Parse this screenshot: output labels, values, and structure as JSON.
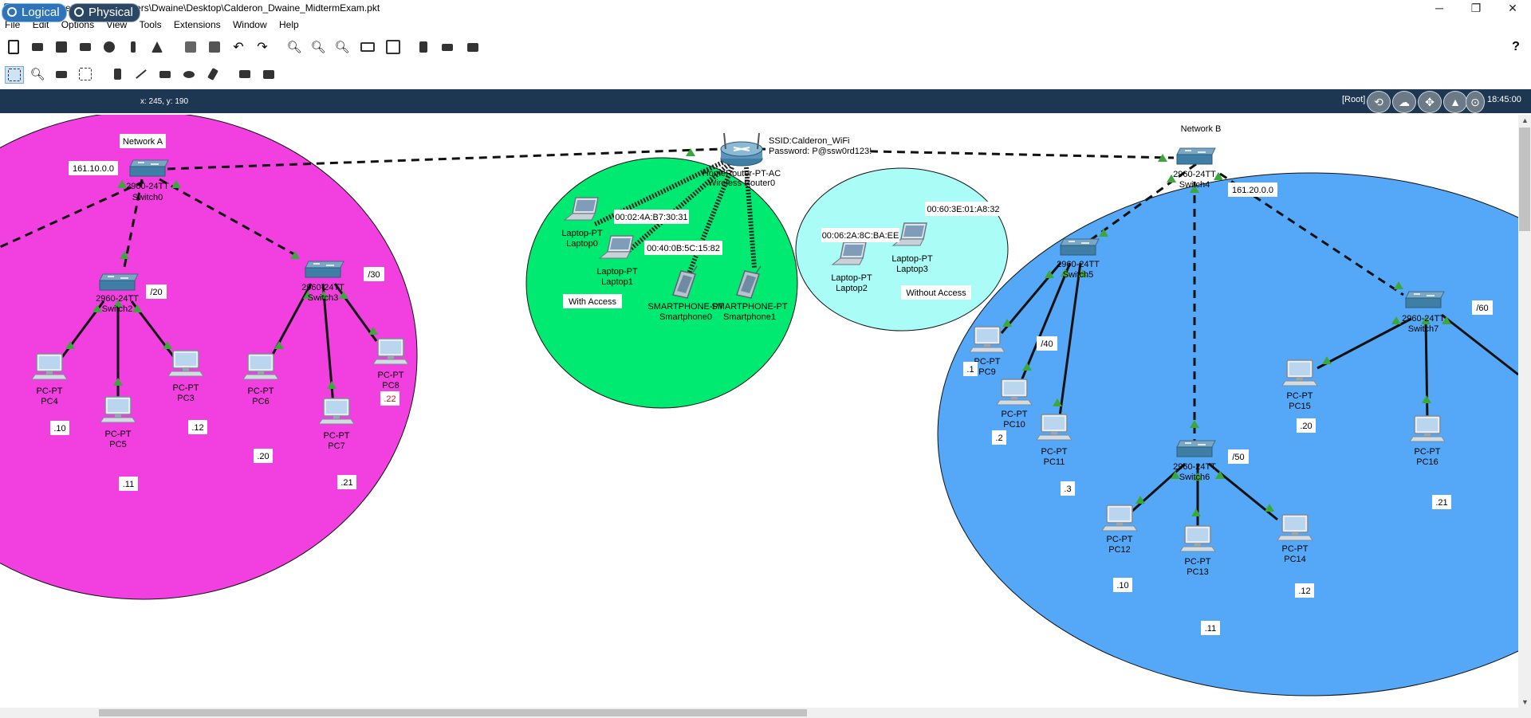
{
  "window": {
    "title": "Cisco Packet Tracer - C:\\Users\\Dwaine\\Desktop\\Calderon_Dwaine_MidtermExam.pkt",
    "controls": [
      "─",
      "❐",
      "✕"
    ]
  },
  "menu": [
    "File",
    "Edit",
    "Options",
    "View",
    "Tools",
    "Extensions",
    "Window",
    "Help"
  ],
  "toolbar_icons": [
    "new-icon",
    "open-icon",
    "save-icon",
    "print-icon",
    "info-icon",
    "wizard-icon",
    "activity-icon",
    "copy-icon",
    "paste-icon",
    "undo-icon",
    "redo-icon",
    "zoom-in-icon",
    "zoom-icon",
    "zoom-out-icon",
    "drawing-palette-icon",
    "custom-device-icon",
    "notes-icon",
    "viewport-icon",
    "cluster-icon"
  ],
  "toolbar2_icons": [
    "select-icon",
    "inspect-icon",
    "delete-icon",
    "resize-icon",
    "note-icon",
    "line-icon",
    "rectangle-icon",
    "ellipse-icon",
    "freeform-icon",
    "add-simple-pdu-icon",
    "add-complex-pdu-icon"
  ],
  "help_label": "?",
  "workspace": {
    "logical": "Logical",
    "physical": "Physical",
    "coords": "x: 245, y: 190",
    "root": "[Root]",
    "time": "18:45:00"
  },
  "areas": {
    "network_a": "Network A",
    "network_b": "Network B",
    "with_access": "With Access",
    "without_access": "Without Access"
  },
  "router": {
    "model": "HomeRouter-PT-AC",
    "name": "Wireless Router0",
    "ssid": "SSID:Calderon_WiFi",
    "password": "Password: P@ssw0rd123!"
  },
  "devices": {
    "switch0": {
      "model": "2960-24TT",
      "name": "Switch0"
    },
    "switch2": {
      "model": "2960-24TT",
      "name": "Switch2"
    },
    "switch3": {
      "model": "2960-24TT",
      "name": "Switch3"
    },
    "switch4": {
      "model": "2960-24TT",
      "name": "Switch4"
    },
    "switch5": {
      "model": "2960-24TT",
      "name": "Switch5"
    },
    "switch6": {
      "model": "2960-24TT",
      "name": "Switch6"
    },
    "switch7": {
      "model": "2960-24TT",
      "name": "Switch7"
    },
    "pc3": {
      "model": "PC-PT",
      "name": "PC3"
    },
    "pc4": {
      "model": "PC-PT",
      "name": "PC4"
    },
    "pc5": {
      "model": "PC-PT",
      "name": "PC5"
    },
    "pc6": {
      "model": "PC-PT",
      "name": "PC6"
    },
    "pc7": {
      "model": "PC-PT",
      "name": "PC7"
    },
    "pc8": {
      "model": "PC-PT",
      "name": "PC8"
    },
    "pc9": {
      "model": "PC-PT",
      "name": "PC9"
    },
    "pc10": {
      "model": "PC-PT",
      "name": "PC10"
    },
    "pc11": {
      "model": "PC-PT",
      "name": "PC11"
    },
    "pc12": {
      "model": "PC-PT",
      "name": "PC12"
    },
    "pc13": {
      "model": "PC-PT",
      "name": "PC13"
    },
    "pc14": {
      "model": "PC-PT",
      "name": "PC14"
    },
    "pc15": {
      "model": "PC-PT",
      "name": "PC15"
    },
    "pc16": {
      "model": "PC-PT",
      "name": "PC16"
    },
    "laptop0": {
      "model": "Laptop-PT",
      "name": "Laptop0"
    },
    "laptop1": {
      "model": "Laptop-PT",
      "name": "Laptop1"
    },
    "laptop2": {
      "model": "Laptop-PT",
      "name": "Laptop2"
    },
    "laptop3": {
      "model": "Laptop-PT",
      "name": "Laptop3"
    },
    "smartphone0": {
      "model": "SMARTPHONE-PT",
      "name": "Smartphone0"
    },
    "smartphone1": {
      "model": "SMARTPHONE-PT",
      "name": "Smartphone1"
    }
  },
  "notes": {
    "net_a": "161.10.0.0",
    "net_b": "161.20.0.0",
    "mac1": "00:02:4A:B7:30:31",
    "mac2": "00:40:0B:5C:15:82",
    "mac3": "00:06:2A:8C:BA:EE",
    "mac4": "00:60:3E:01:A8:32",
    "s20": "/20",
    "s30": "/30",
    "s40": "/40",
    "s50": "/50",
    "s60": "/60",
    "a10": ".10",
    "a11": ".11",
    "a12": ".12",
    "a20": ".20",
    "a21": ".21",
    "a22": ".22",
    "b1": ".1",
    "b2": ".2",
    "b3": ".3",
    "b10": ".10",
    "b11": ".11",
    "b12": ".12",
    "b20": ".20",
    "b21": ".21"
  },
  "colors": {
    "network_a": "#f23fe0",
    "network_b": "#55a8f7",
    "with_access": "#00ea72",
    "without_access": "#aafcf6",
    "workspace_bar": "#1d3752",
    "link_up": "#3ca83c"
  }
}
